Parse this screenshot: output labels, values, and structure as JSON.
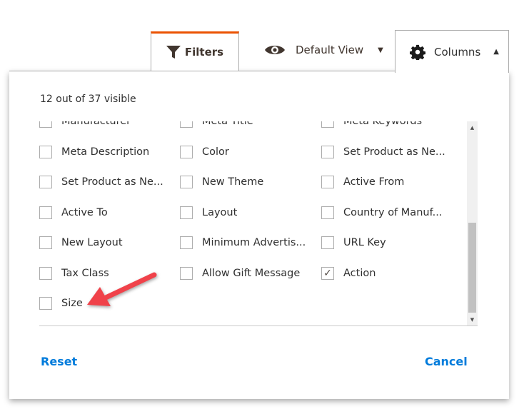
{
  "tabs": {
    "filters": "Filters",
    "default_view": "Default View",
    "columns": "Columns"
  },
  "columns_panel": {
    "visible_count": "12 out of 37 visible",
    "items": [
      [
        "Manufacturer",
        "Meta Title",
        "Meta Keywords"
      ],
      [
        "Meta Description",
        "Color",
        "Set Product as Ne..."
      ],
      [
        "Set Product as Ne...",
        "New Theme",
        "Active From"
      ],
      [
        "Active To",
        "Layout",
        "Country of Manuf..."
      ],
      [
        "New Layout",
        "Minimum Advertis...",
        "URL Key"
      ],
      [
        "Tax Class",
        "Allow Gift Message",
        "Action"
      ],
      [
        "Size"
      ]
    ],
    "checked": [
      "Action"
    ],
    "reset": "Reset",
    "cancel": "Cancel"
  },
  "colors": {
    "accent_tab": "#eb5202",
    "link": "#007bdb",
    "annotation_arrow": "#f0424a"
  }
}
